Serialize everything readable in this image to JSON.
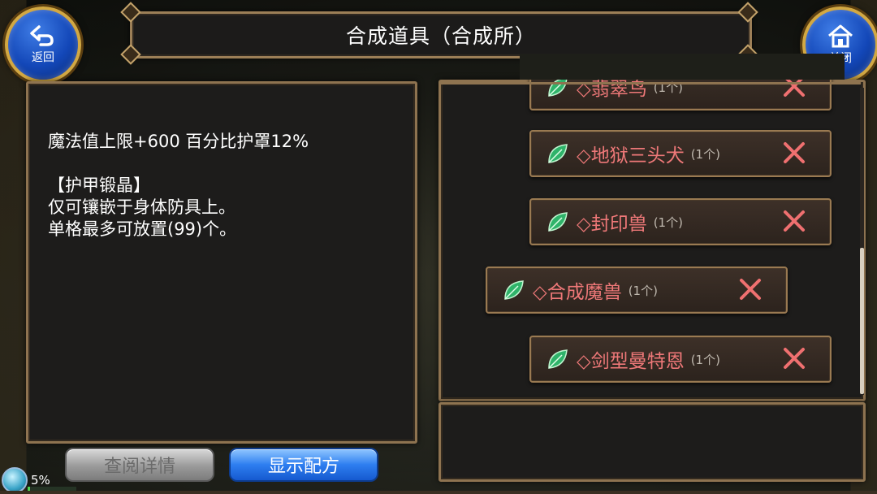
{
  "header": {
    "title": "合成道具（合成所）"
  },
  "back_button": {
    "label": "返回",
    "icon": "back-arrow-icon"
  },
  "close_button": {
    "label": "关闭",
    "icon": "home-icon"
  },
  "description": {
    "lines": [
      "魔法值上限+600 百分比护罩12%",
      "",
      "【护甲锻晶】",
      "仅可镶嵌于身体防具上。",
      "单格最多可放置(99)个。"
    ]
  },
  "materials": [
    {
      "name": "◇翡翠鸟",
      "qty": "(1个)",
      "icon": "leaf-icon"
    },
    {
      "name": "◇地狱三头犬",
      "qty": "(1个)",
      "icon": "leaf-icon"
    },
    {
      "name": "◇封印兽",
      "qty": "(1个)",
      "icon": "leaf-icon"
    },
    {
      "name": "◇合成魔兽",
      "qty": "(1个)",
      "icon": "leaf-icon",
      "selected": true
    },
    {
      "name": "◇剑型曼特恩",
      "qty": "(1个)",
      "icon": "leaf-icon"
    }
  ],
  "buttons": {
    "detail": "查阅详情",
    "recipe": "显示配方"
  },
  "status": {
    "percent_label": "5%",
    "progress": 0.05
  },
  "colors": {
    "material_name": "#ee7878",
    "panel_border": "#8e7350",
    "recipe_button": "#2e7ef0"
  }
}
